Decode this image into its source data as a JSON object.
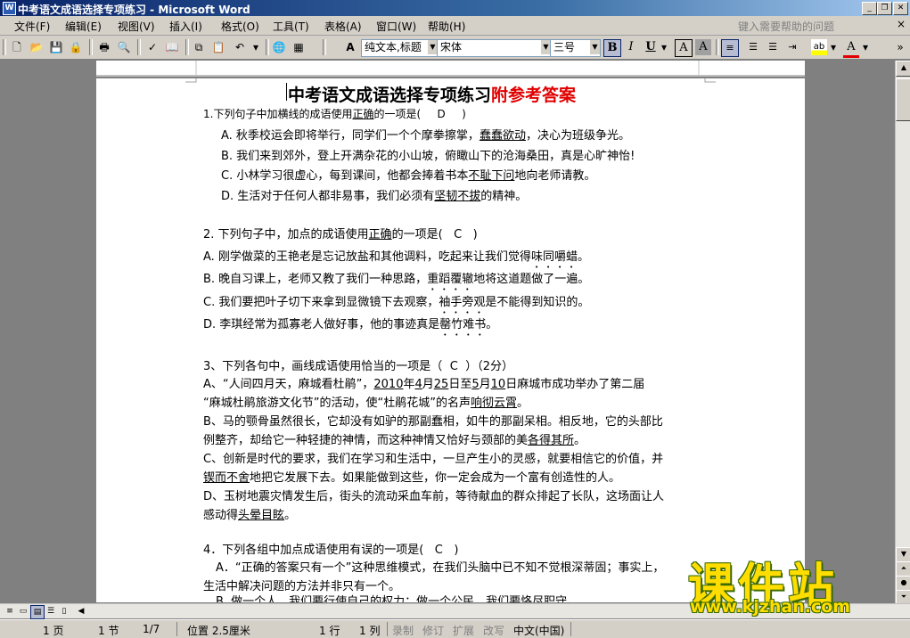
{
  "window": {
    "title": "中考语文成语选择专项练习 - Microsoft Word",
    "min": "_",
    "max": "❐",
    "close": "✕"
  },
  "menubar": {
    "items": [
      "文件(F)",
      "编辑(E)",
      "视图(V)",
      "插入(I)",
      "格式(O)",
      "工具(T)",
      "表格(A)",
      "窗口(W)",
      "帮助(H)"
    ],
    "help_search": "键入需要帮助的问题",
    "close_doc": "×"
  },
  "toolbar": {
    "style": "纯文本,标题",
    "font": "宋体",
    "size": "三号",
    "bold": "B",
    "italic": "I",
    "underline": "U",
    "char_border": "A",
    "char_shading": "A",
    "font_color": "A",
    "highlight": "ab"
  },
  "document": {
    "title_black": "中考语文成语选择专项练习",
    "title_red": "附参考答案",
    "q1": {
      "stem_a": "1.下列句子中加横线的成语使用",
      "stem_b": "正确",
      "stem_c": "的一项是(",
      "answer": "D",
      "stem_close": ")",
      "A_a": "A. 秋季校运会即将举行，同学们一个个摩拳擦掌，",
      "A_b": "蠢蠢欲动",
      "A_c": "，决心为班级争光。",
      "B": "B. 我们来到郊外，登上开满杂花的小山坡，俯瞰山下的沧海桑田，真是心旷神怡!",
      "C_a": "C. 小林学习很虚心，每到课间，他都会捧着书本",
      "C_b": "不耻下问",
      "C_c": "地向老师请教。",
      "D_a": "D. 生活对于任何人都非易事，我们必须有",
      "D_b": "坚韧不拔",
      "D_c": "的精神。"
    },
    "q2": {
      "stem_a": "2. 下列句子中，加点的成语使用",
      "stem_b": "正确",
      "stem_c": "的一项是(",
      "answer": "C",
      "stem_close": ")",
      "A_a": "A. 刚学做菜的王艳老是忘记放盐和其他调料，吃起来让我们觉得",
      "A_b": "味同嚼蜡",
      "A_c": "。",
      "B_a": "B. 晚自习课上，老师又教了我们一种思路，",
      "B_b": "重蹈覆辙",
      "B_c": "地将这道题做了一遍。",
      "C_a": "C. 我们要把叶子切下来拿到显微镜下去观察，",
      "C_b": "袖手旁观",
      "C_c": "是不能得到知识的。",
      "D_a": "D. 李琪经常为孤寡老人做好事，他的事迹真是",
      "D_b": "罄竹难书",
      "D_c": "。"
    },
    "q3": {
      "stem": "3、下列各句中，画线成语使用恰当的一项是（",
      "answer": "C",
      "stem_close": "）（2分）",
      "A1_a": "A、“人间四月天，麻城看杜鹃”，",
      "A1_b": "2010",
      "A1_c": "年",
      "A1_d": "4",
      "A1_e": "月",
      "A1_f": "25",
      "A1_g": "日至",
      "A1_h": "5",
      "A1_i": "月",
      "A1_j": "10",
      "A1_k": "日麻城市成功举办了第二届",
      "A2_a": "“麻城杜鹃旅游文化节”的活动，使“杜鹃花城”的名声",
      "A2_b": "响彻云霄",
      "A2_c": "。",
      "B1": "B、马的颚骨虽然很长，它却没有如驴的那副蠢相，如牛的那副呆相。相反地，它的头部比",
      "B2_a": "例整齐，却给它一种轻捷的神情，而这种神情又恰好与颈部的美",
      "B2_b": "各得其所",
      "B2_c": "。",
      "C1": "C、创新是时代的要求，我们在学习和生活中，一旦产生小的灵感，就要相信它的价值，并",
      "C2_a": "锲而不舍",
      "C2_b": "地把它发展下去。如果能做到这些，你一定会成为一个富有创造性的人。",
      "D1": "D、玉树地震灾情发生后，街头的流动采血车前，等待献血的群众排起了长队，这场面让人",
      "D2_a": "感动得",
      "D2_b": "头晕目眩",
      "D2_c": "。"
    },
    "q4": {
      "stem": "4．下列各组中加点成语使用有误的一项是(",
      "answer": "C",
      "stem_close": ")",
      "A1": "A．“正确的答案只有一个”这种思维模式，在我们头脑中已不知不觉根深蒂固；事实上，",
      "A2": "生活中解决问题的方法并非只有一个。",
      "B1": "B. 做一个人，我们要行使自己的权力；做一个公民，我们要恪尽职守。"
    }
  },
  "statusbar": {
    "page": "1 页",
    "section": "1 节",
    "pages": "1/7",
    "position": "位置 2.5厘米",
    "line": "1 行",
    "col": "1 列",
    "rec": "录制",
    "trk": "修订",
    "ext": "扩展",
    "ovr": "改写",
    "lang": "中文(中国)"
  },
  "watermark": {
    "big": "课件站",
    "url": "www.kjzhan.com"
  }
}
